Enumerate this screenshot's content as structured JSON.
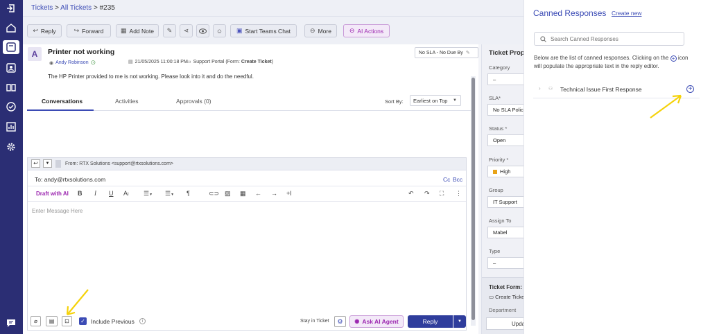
{
  "breadcrumb": {
    "root": "Tickets",
    "sep": ">",
    "all": "All Tickets",
    "id": "#235"
  },
  "toolbar": {
    "reply": "Reply",
    "forward": "Forward",
    "add_note": "Add Note",
    "teams": "Start Teams Chat",
    "more": "More",
    "ai_actions": "AI Actions"
  },
  "ticket": {
    "avatar_letter": "A",
    "subject": "Printer not working",
    "requester": "Andy Robinson",
    "date": "21/05/2025 11:00:18 PM",
    "source_prefix": "Support Portal (Form:",
    "source_form": "Create Ticket",
    "source_suffix": ")",
    "description": "The HP Printer provided to me is not working. Please look into it and do the needful.",
    "sla": "No SLA - No Due By"
  },
  "tabs": {
    "conversations": "Conversations",
    "activities": "Activities",
    "approvals": "Approvals (0)"
  },
  "sort": {
    "label": "Sort By:",
    "value": "Earliest on Top"
  },
  "editor": {
    "from": "From: RTX Solutions <support@rtxsolutions.com>",
    "to": "To: andy@rtxsolutions.com",
    "cc": "Cc",
    "bcc": "Bcc",
    "draft_ai": "Draft with AI",
    "placeholder": "Enter Message Here",
    "include_previous": "Include Previous",
    "stay_in_ticket": "Stay in Ticket",
    "ask_ai": "Ask AI Agent",
    "reply": "Reply"
  },
  "properties": {
    "title": "Ticket Properties",
    "category_label": "Category",
    "category_value": "–",
    "sla_label": "SLA*",
    "sla_value": "No SLA Policy",
    "status_label": "Status *",
    "status_value": "Open",
    "priority_label": "Priority *",
    "priority_value": "High",
    "group_label": "Group",
    "group_value": "IT Support",
    "assign_label": "Assign To",
    "assign_value": "Mabel",
    "type_label": "Type",
    "type_value": "–",
    "form_label": "Ticket Form:",
    "form_value": "Create Ticket",
    "department_label": "Department",
    "update_button": "Update"
  },
  "canned": {
    "title": "Canned Responses",
    "create_new": "Create new",
    "search_placeholder": "Search Canned Responses",
    "desc_1": "Below are the list of canned responses. Clicking on the",
    "desc_2": "icon",
    "desc_3": "will populate the appropriate text in the reply editor.",
    "item": "Technical Issue First Response"
  },
  "colors": {
    "nav": "#2b2e74",
    "accent": "#3b4bb5",
    "ai_purple": "#9c27b0",
    "arrow": "#f5d20a"
  }
}
